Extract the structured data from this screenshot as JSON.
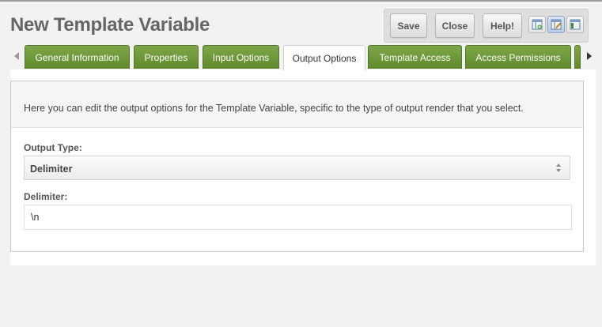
{
  "page": {
    "title": "New Template Variable"
  },
  "toolbar": {
    "buttons": [
      {
        "label": "Save"
      },
      {
        "label": "Close"
      },
      {
        "label": "Help!"
      }
    ],
    "view_icons": [
      "layout-new-icon",
      "layout-edit-icon",
      "layout-split-icon"
    ],
    "active_view": 1
  },
  "tabs": [
    {
      "label": "General Information"
    },
    {
      "label": "Properties"
    },
    {
      "label": "Input Options"
    },
    {
      "label": "Output Options"
    },
    {
      "label": "Template Access"
    },
    {
      "label": "Access Permissions"
    }
  ],
  "active_tab": 3,
  "panel": {
    "description": "Here you can edit the output options for the Template Variable, specific to the type of output render that you select.",
    "output_type": {
      "label": "Output Type:",
      "value": "Delimiter"
    },
    "delimiter": {
      "label": "Delimiter:",
      "value": "\\n"
    }
  },
  "colors": {
    "tab_green": "#6b9636",
    "tab_active": "#ffffff",
    "title_gray": "#666666",
    "active_view_blue": "#b8cbe4"
  }
}
